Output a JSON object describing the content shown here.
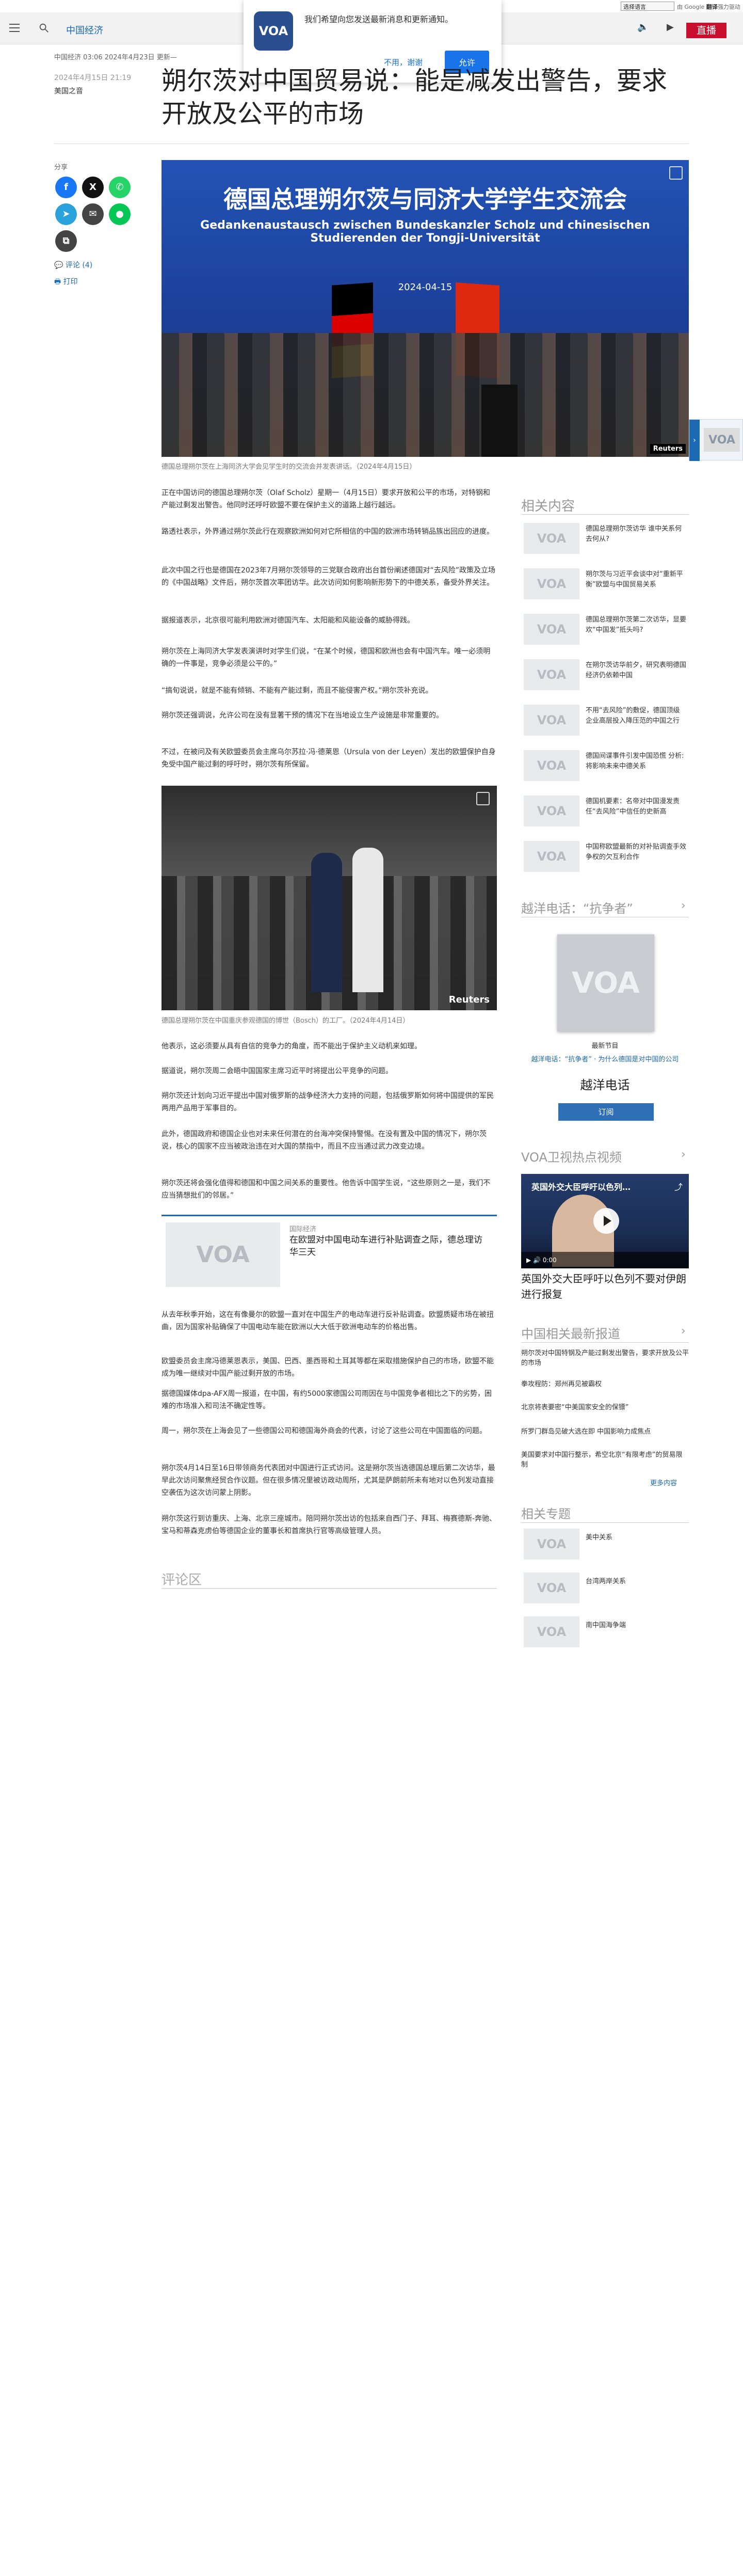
{
  "langbar": {
    "select": "选择语言",
    "powered": "由 Google ",
    "translate_brand": "翻译",
    "translate_label": "强力驱动"
  },
  "nav": {
    "section": "中国经济",
    "live": "直播"
  },
  "logo": "VOA",
  "popup": {
    "text": "我们希望向您发送最新消息和更新通知。",
    "decline": "不用，谢谢",
    "accept": "允许"
  },
  "article": {
    "breadcrumb": "中国经济 03:06 2024年4月23日 更新—",
    "date": "2024年4月15日 21:19",
    "author": "美国之音",
    "title": "朔尔茨对中国贸易说：能是减发出警告，要求开放及公平的市场",
    "share_label": "分享",
    "comments_link": "评论 (4)",
    "print_link": "打印",
    "hero": {
      "banner_zh": "德国总理朔尔茨与同济大学学生交流会",
      "banner_de": "Gedankenaustausch zwischen Bundeskanzler Scholz und chinesischen Studierenden der Tongji-Universität",
      "banner_date": "2024-04-15",
      "credit": "Reuters"
    },
    "hero_caption": "德国总理朔尔茨在上海同济大学会见学生时的交流会并发表讲话。（2024年4月15日）",
    "paragraphs_a": [
      "正在中国访问的德国总理朔尔茨（Olaf Scholz）星期一（4月15日）要求开放和公平的市场，对特钢和产能过剩发出警告。他同时还呼吁欧盟不要在保护主义的道路上越行越远。",
      "路透社表示，外界通过朔尔茨此行在观察欧洲如何对它所相信的中国的欧洲市场转销品族出回应的进度。",
      "此次中国之行也是德国在2023年7月朔尔茨领导的三党联合政府出台首份阐述德国对“去风险”政策及立场的《中国战略》文件后，朔尔茨首次率团访华。此次访问如何影响新形势下的中德关系，备受外界关注。",
      "据报道表示，北京很可能利用欧洲对德国汽车、太阳能和风能设备的威胁得践。",
      "朔尔茨在上海同济大学发表演讲时对学生们说，“在某个时候，德国和欧洲也会有中国汽车。唯一必须明确的一件事是，竞争必须是公平的。”",
      "“搞旬说说，就是不能有倾销、不能有产能过剩，而且不能侵害产权。”朔尔茨补充说。",
      "朔尔茨还强调说，允许公司在没有显著干预的情况下在当地设立生产设施是非常重要的。",
      "不过，在被问及有关欧盟委员会主席乌尔苏拉·冯·德莱恩（Ursula von der Leyen）发出的欧盟保护自身免受中国产能过剩的呼吁时，朔尔茨有所保留。"
    ],
    "photo2_credit": "Reuters",
    "photo2_caption": "德国总理朔尔茨在中国重庆参观德国的博世（Bosch）的工厂。（2024年4月14日）",
    "paragraphs_b": [
      "他表示，这必须要从具有自信的竞争力的角度，而不能出于保护主义动机来如理。",
      "据道说，朔尔茨周二会晤中国国家主席习近平时将提出公平竞争的问题。",
      "朔尔茨还计划向习近平提出中国对俄罗斯的战争经济大力支持的问题，包括俄罗斯如何将中国提供的军民两用产品用于军事目的。",
      "此外，德国政府和德国企业也对未来任何潜在的台海冲突保持警惕。在没有置及中国的情况下，朔尔茨说，核心的国家不应当被政治违在对大国的禁指中，而且不应当通过武力改变边境。",
      "朔尔茨还将会强化值得和德国和中国之间关系的重要性。他告诉中国学生说，“这些原则之一是，我们不应当猜想批们的邻居。”"
    ],
    "related_card": {
      "category": "国际经济",
      "title": "在欧盟对中国电动车进行补贴调查之际，德总理访华三天"
    },
    "paragraphs_c": [
      "从去年秋季开始，这在有像曼尔的欧盟一直对在中国生产的电动车进行反补贴调查。欧盟质疑市场在被扭曲，因为国家补贴确保了中国电动车能在欧洲以大大低于欧洲电动车的价格出售。",
      "欧盟委员会主席冯德莱恩表示，美国、巴西、墨西哥和土耳其等都在采取措施保护自己的市场，欧盟不能成为唯一继续对中国产能过剩开放的市场。",
      "据德国媒体dpa-AFX周一报道，在中国，有约5000家德国公司雨因在与中国竞争者相比之下的劣势，困难的市场准入和司法不确定性等。",
      "周一，朔尔茨在上海会见了一些德国公司和德国海外商会的代表，讨论了这些公司在中国面临的问题。",
      "朔尔茨4月14日至16日带领商务代表团对中国进行正式访问。这是朔尔茨当选德国总理后第二次访华，最早此次访问聚焦经贸合作议题。但在很多情况里被访政动周所，尤其是萨朗前所未有地对以色列发动直接空袭伍为这次访问蒙上阴影。",
      "朔尔茨这行到访重庆、上海、北京三座城市。陪同朔尔茨出访的包括来自西门子、拜耳、梅赛德斯-奔驰、宝马和蒂森克虏伯等德国企业的董事长和首席执行官等高级管理人员。"
    ],
    "comments_heading": "评论区"
  },
  "sidebar": {
    "related_heading": "相关内容",
    "related": [
      "德国总理朔尔茨访华 谁中关系何去何从?",
      "朔尔茨与习近平会谈中对“重新平衡”欧盟与中国贸易关系",
      "德国总理朔尔茨第二次访华，显要欢“中国发”抵头吗?",
      "在朔尔茨访华前夕，研究表明德国经济仍依赖中国",
      "不用“去风险”的敷促，德国顶级企业高层投入降压范的中国之行",
      "德国间谍事件引发中国恐慌 分析: 将影响未来中德关系",
      "德国机要素：名帝对中国漫发责任“去风险”中信任的史新高",
      "中国称欧盟最新的对补贴调查手效争权的欠互利合作"
    ],
    "podcast_heading": "越洋电话：“抗争者”",
    "podcast": {
      "latest": "最新节目",
      "links": "越洋电话：“抗争者” · 为什么德国是对中国的公司",
      "name": "越洋电话",
      "subscribe": "订阅"
    },
    "video_heading": "VOA卫视热点视频",
    "video": {
      "overlay_title": "英国外交大臣呼吁以色列…",
      "time": "0:00",
      "title": "英国外交大臣呼吁以色列不要对伊朗进行报复"
    },
    "news_heading": "中国相关最新报道",
    "news": [
      "朔尔茨对中国特钢及产能过剩发出警告，要求开放及公平的市场",
      "拳攻程防：郑州再见被霸权",
      "北京将表要密“中美国家安全的保镖”",
      "所罗门群岛见破大选在即 中国影响力成焦点",
      "美国要求对中国行整示，希空北京“有限考虑”的贸易限制"
    ],
    "news_more": "更多内容",
    "topics_heading": "相关专题",
    "topics": [
      "美中关系",
      "台湾两岸关系",
      "南中国海争端"
    ]
  },
  "colors": {
    "accent": "#1c6ab3",
    "live": "#c8102e",
    "voa_navy": "#2b4f8e"
  },
  "icons": [
    "menu-icon",
    "search-icon",
    "speaker-icon",
    "video-icon",
    "facebook-icon",
    "x-icon",
    "whatsapp-icon",
    "telegram-icon",
    "email-icon",
    "line-icon",
    "copy-link-icon",
    "comment-icon",
    "print-icon",
    "expand-icon",
    "chevron-right-icon",
    "play-icon",
    "share-icon"
  ]
}
